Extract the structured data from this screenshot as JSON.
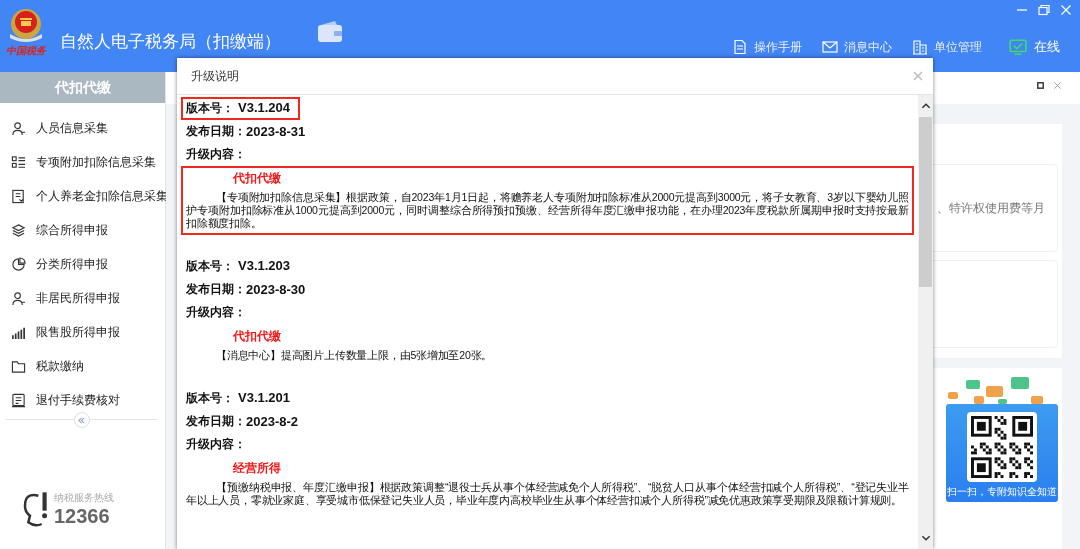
{
  "window": {
    "title": "自然人电子税务局（扣缴端）",
    "logo_text": "中国税务"
  },
  "top_links": [
    {
      "label": "操作手册",
      "kind": "manual"
    },
    {
      "label": "消息中心",
      "kind": "message"
    },
    {
      "label": "单位管理",
      "kind": "org"
    },
    {
      "label": "在线",
      "kind": "online"
    }
  ],
  "sidebar": {
    "tab": "代扣代缴",
    "items": [
      {
        "label": "人员信息采集",
        "kind": "person"
      },
      {
        "label": "专项附加扣除信息采集",
        "kind": "list"
      },
      {
        "label": "个人养老金扣除信息采集",
        "kind": "doc"
      },
      {
        "label": "综合所得申报",
        "kind": "layers"
      },
      {
        "label": "分类所得申报",
        "kind": "pie"
      },
      {
        "label": "非居民所得申报",
        "kind": "person"
      },
      {
        "label": "限售股所得申报",
        "kind": "bars"
      },
      {
        "label": "税款缴纳",
        "kind": "folder"
      },
      {
        "label": "退付手续费核对",
        "kind": "doc2"
      }
    ],
    "hotline": {
      "label": "纳税服务热线",
      "number": "12366"
    }
  },
  "background": {
    "snippet": "、特许权使用费等月",
    "qr_caption": "扫一扫，专附知识全知道"
  },
  "dialog": {
    "title": "升级说明",
    "entries": [
      {
        "version_label": "版本号：",
        "version": "V3.1.204",
        "version_highlighted": true,
        "date_label": "发布日期：",
        "date": "2023-8-31",
        "content_label": "升级内容：",
        "content_highlighted": true,
        "category": "代扣代缴",
        "text": "【专项附加扣除信息采集】根据政策，自2023年1月1日起，将赡养老人专项附加扣除标准从2000元提高到3000元，将子女教育、3岁以下婴幼儿照护专项附加扣除标准从1000元提高到2000元，同时调整综合所得预扣预缴、经营所得年度汇缴申报功能，在办理2023年度税款所属期申报时支持按最新扣除额度扣除。"
      },
      {
        "version_label": "版本号：",
        "version": "V3.1.203",
        "version_highlighted": false,
        "date_label": "发布日期：",
        "date": "2023-8-30",
        "content_label": "升级内容：",
        "content_highlighted": false,
        "category": "代扣代缴",
        "text": "【消息中心】提高图片上传数量上限，由5张增加至20张。"
      },
      {
        "version_label": "版本号：",
        "version": "V3.1.201",
        "version_highlighted": false,
        "date_label": "发布日期：",
        "date": "2023-8-2",
        "content_label": "升级内容：",
        "content_highlighted": false,
        "category": "经营所得",
        "text": "【预缴纳税申报、年度汇缴申报】根据政策调整“退役士兵从事个体经营减免个人所得税”、“脱贫人口从事个体经营扣减个人所得税”、“登记失业半年以上人员，零就业家庭、享受城市低保登记失业人员，毕业年度内高校毕业生从事个体经营扣减个人所得税”减免优惠政策享受期限及限额计算规则。"
      }
    ]
  }
}
